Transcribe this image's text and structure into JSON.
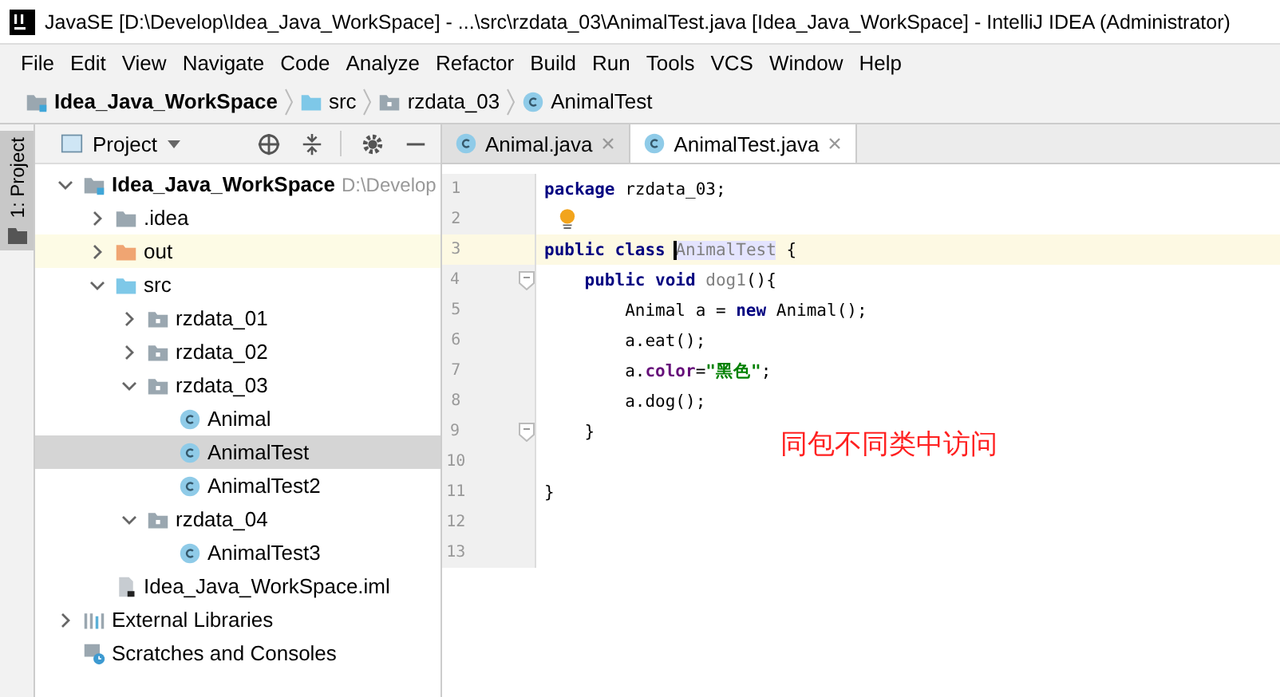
{
  "window": {
    "title": "JavaSE [D:\\Develop\\Idea_Java_WorkSpace] - ...\\src\\rzdata_03\\AnimalTest.java [Idea_Java_WorkSpace] - IntelliJ IDEA (Administrator)"
  },
  "menu": [
    "File",
    "Edit",
    "View",
    "Navigate",
    "Code",
    "Analyze",
    "Refactor",
    "Build",
    "Run",
    "Tools",
    "VCS",
    "Window",
    "Help"
  ],
  "breadcrumbs": [
    {
      "label": "Idea_Java_WorkSpace",
      "kind": "module"
    },
    {
      "label": "src",
      "kind": "source"
    },
    {
      "label": "rzdata_03",
      "kind": "package"
    },
    {
      "label": "AnimalTest",
      "kind": "class"
    }
  ],
  "side_strip": {
    "label": "1: Project"
  },
  "project_panel": {
    "title": "Project",
    "tree": [
      {
        "label": "Idea_Java_WorkSpace",
        "hint": "D:\\Develop",
        "kind": "module",
        "expanded": true,
        "selected": false,
        "highlighted": false,
        "children": [
          {
            "label": ".idea",
            "kind": "folder",
            "expanded": false,
            "selected": false,
            "highlighted": false
          },
          {
            "label": "out",
            "kind": "excluded",
            "expanded": false,
            "selected": false,
            "highlighted": true
          },
          {
            "label": "src",
            "kind": "source",
            "expanded": true,
            "selected": false,
            "highlighted": false,
            "children": [
              {
                "label": "rzdata_01",
                "kind": "package",
                "expanded": false,
                "selected": false,
                "highlighted": false
              },
              {
                "label": "rzdata_02",
                "kind": "package",
                "expanded": false,
                "selected": false,
                "highlighted": false
              },
              {
                "label": "rzdata_03",
                "kind": "package",
                "expanded": true,
                "selected": false,
                "highlighted": false,
                "children": [
                  {
                    "label": "Animal",
                    "kind": "class",
                    "selected": false,
                    "highlighted": false
                  },
                  {
                    "label": "AnimalTest",
                    "kind": "class",
                    "selected": true,
                    "highlighted": false
                  },
                  {
                    "label": "AnimalTest2",
                    "kind": "class",
                    "selected": false,
                    "highlighted": false
                  }
                ]
              },
              {
                "label": "rzdata_04",
                "kind": "package",
                "expanded": true,
                "selected": false,
                "highlighted": false,
                "children": [
                  {
                    "label": "AnimalTest3",
                    "kind": "class",
                    "selected": false,
                    "highlighted": false
                  }
                ]
              }
            ]
          },
          {
            "label": "Idea_Java_WorkSpace.iml",
            "kind": "iml",
            "selected": false,
            "highlighted": false
          }
        ]
      },
      {
        "label": "External Libraries",
        "kind": "libraries",
        "expanded": false,
        "selected": false,
        "highlighted": false
      },
      {
        "label": "Scratches and Consoles",
        "kind": "scratches",
        "selected": false,
        "highlighted": false
      }
    ]
  },
  "tabs": [
    {
      "label": "Animal.java",
      "selected": false
    },
    {
      "label": "AnimalTest.java",
      "selected": true
    }
  ],
  "code": [
    {
      "number": "1",
      "current": false,
      "fold": false,
      "bulb": false,
      "tokens": [
        {
          "kind": "kw",
          "text": "package"
        },
        {
          "kind": "plain",
          "text": " rzdata_03;"
        }
      ]
    },
    {
      "number": "2",
      "current": false,
      "fold": false,
      "bulb": true
    },
    {
      "number": "3",
      "current": true,
      "fold": false,
      "bulb": false,
      "tokens": [
        {
          "kind": "kw",
          "text": "public class "
        },
        {
          "kind": "usage",
          "text": "AnimalTest"
        },
        {
          "kind": "plain",
          "text": " {"
        }
      ]
    },
    {
      "number": "4",
      "current": false,
      "fold": true,
      "bulb": false,
      "tokens": [
        {
          "kind": "kw",
          "text": "    public void "
        },
        {
          "kind": "muted",
          "text": "dog1"
        },
        {
          "kind": "plain",
          "text": "(){"
        }
      ]
    },
    {
      "number": "5",
      "current": false,
      "fold": false,
      "bulb": false,
      "tokens": [
        {
          "kind": "plain",
          "text": "        Animal a = "
        },
        {
          "kind": "kw",
          "text": "new"
        },
        {
          "kind": "plain",
          "text": " Animal();"
        }
      ]
    },
    {
      "number": "6",
      "current": false,
      "fold": false,
      "bulb": false,
      "tokens": [
        {
          "kind": "plain",
          "text": "        a.eat();"
        }
      ]
    },
    {
      "number": "7",
      "current": false,
      "fold": false,
      "bulb": false,
      "tokens": [
        {
          "kind": "plain",
          "text": "        a."
        },
        {
          "kind": "field",
          "text": "color"
        },
        {
          "kind": "plain",
          "text": "="
        },
        {
          "kind": "string",
          "text": "\"黑色\""
        },
        {
          "kind": "plain",
          "text": ";"
        }
      ]
    },
    {
      "number": "8",
      "current": false,
      "fold": false,
      "bulb": false,
      "tokens": [
        {
          "kind": "plain",
          "text": "        a.dog();"
        }
      ]
    },
    {
      "number": "9",
      "current": false,
      "fold": true,
      "bulb": false,
      "tokens": [
        {
          "kind": "plain",
          "text": "    }"
        }
      ]
    },
    {
      "number": "10",
      "current": false,
      "fold": false,
      "bulb": false
    },
    {
      "number": "11",
      "current": false,
      "fold": false,
      "bulb": false,
      "tokens": [
        {
          "kind": "plain",
          "text": "}"
        }
      ]
    },
    {
      "number": "12",
      "current": false,
      "fold": false,
      "bulb": false
    },
    {
      "number": "13",
      "current": false,
      "fold": false,
      "bulb": false
    }
  ],
  "annotation": "同包不同类中访问"
}
